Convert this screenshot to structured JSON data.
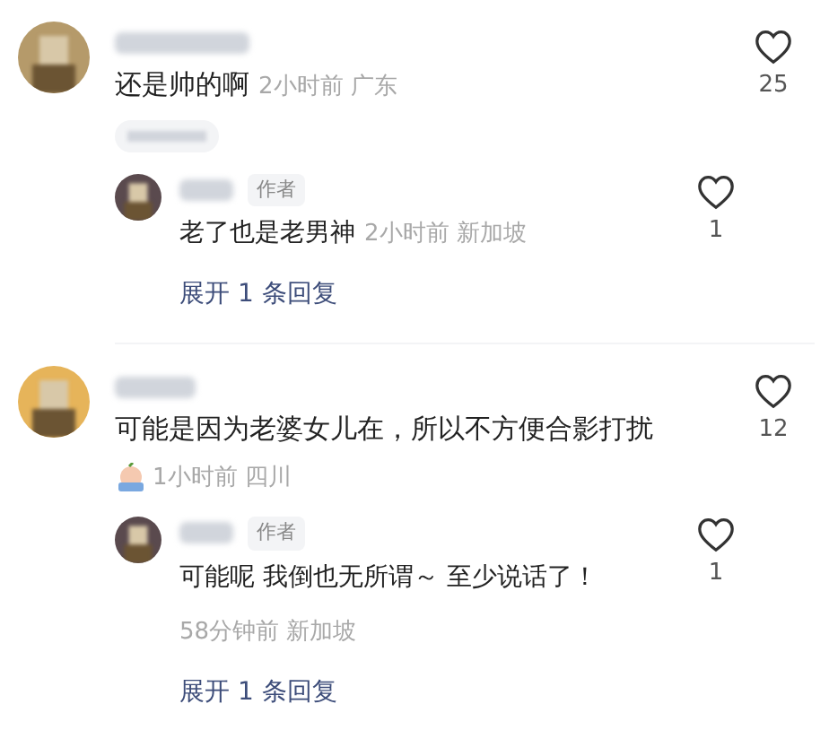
{
  "comments": [
    {
      "text": "还是帅的啊",
      "meta": "2小时前 广东",
      "meta_below": false,
      "tag_pill": true,
      "likes": "25",
      "liked": false,
      "reply": {
        "badge": "作者",
        "text": "老了也是老男神",
        "meta": "2小时前 新加坡",
        "meta_below": false,
        "likes": "1",
        "liked": false
      },
      "expand": "展开 1 条回复"
    },
    {
      "text": "可能是因为老婆女儿在，所以不方便合影打扰",
      "meta": "1小时前 四川",
      "meta_below": true,
      "sticker": true,
      "likes": "12",
      "liked": false,
      "reply": {
        "badge": "作者",
        "text": "可能呢 我倒也无所谓～ 至少说话了！",
        "meta": "58分钟前 新加坡",
        "meta_below": true,
        "likes": "1",
        "liked": false
      },
      "expand": "展开 1 条回复"
    }
  ]
}
